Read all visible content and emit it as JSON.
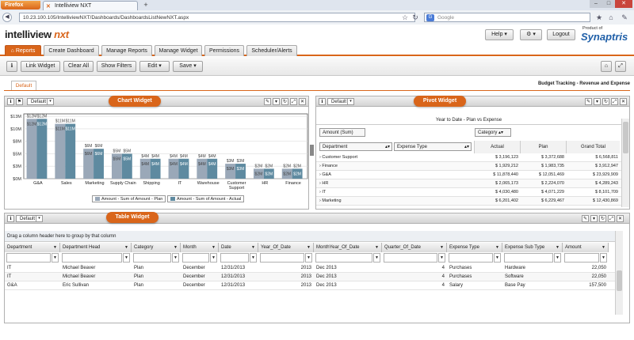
{
  "browser": {
    "menu": "Firefox",
    "tab_title": "Intelliview NXT",
    "url": "10.23.100.105/IntelliviewNXT/Dashboards/DashboardsListNewNXT.aspx",
    "search_placeholder": "Google",
    "search_engine": "G"
  },
  "app": {
    "logo_main": "intelliview",
    "logo_accent": "nxt",
    "help": "Help",
    "logout": "Logout",
    "product_of": "Product of",
    "brand": "Synaptris",
    "accent_color": "#d9651a"
  },
  "tabs": [
    "Reports",
    "Create Dashboard",
    "Manage Reports",
    "Manage Widget",
    "Permissions",
    "Scheduler/Alerts"
  ],
  "toolbar": {
    "link": "Link Widget",
    "clear": "Clear All",
    "filters": "Show Filters",
    "edit": "Edit",
    "save": "Save"
  },
  "dashboard": {
    "tab": "Default",
    "title": "Budget Tracking - Revenue and Expense"
  },
  "widgets": {
    "chart": {
      "label": "Chart Widget",
      "view": "Default",
      "legend": [
        "Amount - Sum of Amount - Plan",
        "Amount - Sum of Amount - Actual"
      ]
    },
    "pivot": {
      "label": "Pivot Widget",
      "view": "Default",
      "title": "Year to Date - Plan vs Expense",
      "measure": "Amount (Sum)",
      "column_field": "Category",
      "row_fields": [
        "Department",
        "Expense Type"
      ],
      "columns": [
        "Actual",
        "Plan",
        "Grand Total"
      ],
      "rows": [
        {
          "name": "Customer Support",
          "actual": "$ 3,196,123",
          "plan": "$ 3,372,688",
          "total": "$ 6,568,811"
        },
        {
          "name": "Finance",
          "actual": "$ 1,929,212",
          "plan": "$ 1,983,735",
          "total": "$ 3,912,947"
        },
        {
          "name": "G&A",
          "actual": "$ 11,878,440",
          "plan": "$ 12,051,469",
          "total": "$ 23,929,909"
        },
        {
          "name": "HR",
          "actual": "$ 2,065,173",
          "plan": "$ 2,224,070",
          "total": "$ 4,289,243"
        },
        {
          "name": "IT",
          "actual": "$ 4,030,480",
          "plan": "$ 4,071,229",
          "total": "$ 8,101,709"
        },
        {
          "name": "Marketing",
          "actual": "$ 6,201,402",
          "plan": "$ 6,229,467",
          "total": "$ 12,430,869"
        }
      ]
    },
    "table": {
      "label": "Table Widget",
      "view": "Default",
      "group_hint": "Drag a column header here to group by that column",
      "columns": [
        "Department",
        "Department Head",
        "Category",
        "Month",
        "Date",
        "Year_Of_Date",
        "MonthYear_Of_Date",
        "Quarter_Of_Date",
        "Expense Type",
        "Expense Sub Type",
        "Amount"
      ],
      "rows": [
        [
          "IT",
          "Michael Beaver",
          "Plan",
          "December",
          "12/31/2013",
          "2013",
          "Dec 2013",
          "4",
          "Purchases",
          "Hardware",
          "22,050"
        ],
        [
          "IT",
          "Michael Beaver",
          "Plan",
          "December",
          "12/31/2013",
          "2013",
          "Dec 2013",
          "4",
          "Purchases",
          "Software",
          "22,050"
        ],
        [
          "G&A",
          "Eric Sullivan",
          "Plan",
          "December",
          "12/31/2013",
          "2013",
          "Dec 2013",
          "4",
          "Salary",
          "Base Pay",
          "157,500"
        ]
      ]
    }
  },
  "chart_data": {
    "type": "bar",
    "categories": [
      "G&A",
      "Sales",
      "Marketing",
      "Supply Chain",
      "Shipping",
      "IT",
      "Warehouse",
      "Customer Support",
      "HR",
      "Finance"
    ],
    "series": [
      {
        "name": "Amount - Sum of Amount - Plan",
        "values": [
          12,
          11,
          6,
          5,
          4,
          4,
          4,
          3,
          2,
          2
        ],
        "labels": [
          "$12M",
          "$11M",
          "$6M",
          "$5M",
          "$4M",
          "$4M",
          "$4M",
          "$3M",
          "$2M",
          "$2M"
        ],
        "color": "#9aa8b8"
      },
      {
        "name": "Amount - Sum of Amount - Actual",
        "values": [
          12,
          11,
          6,
          5,
          4,
          4,
          4,
          3,
          2,
          2
        ],
        "labels": [
          "$12M",
          "$11M",
          "$6M",
          "$5M",
          "$4M",
          "$4M",
          "$4M",
          "$3M",
          "$2M",
          "$2M"
        ],
        "color": "#5e8aa0"
      }
    ],
    "yticks": [
      "$0M",
      "$3M",
      "$5M",
      "$8M",
      "$10M",
      "$13M"
    ],
    "ylim": [
      0,
      13
    ]
  }
}
